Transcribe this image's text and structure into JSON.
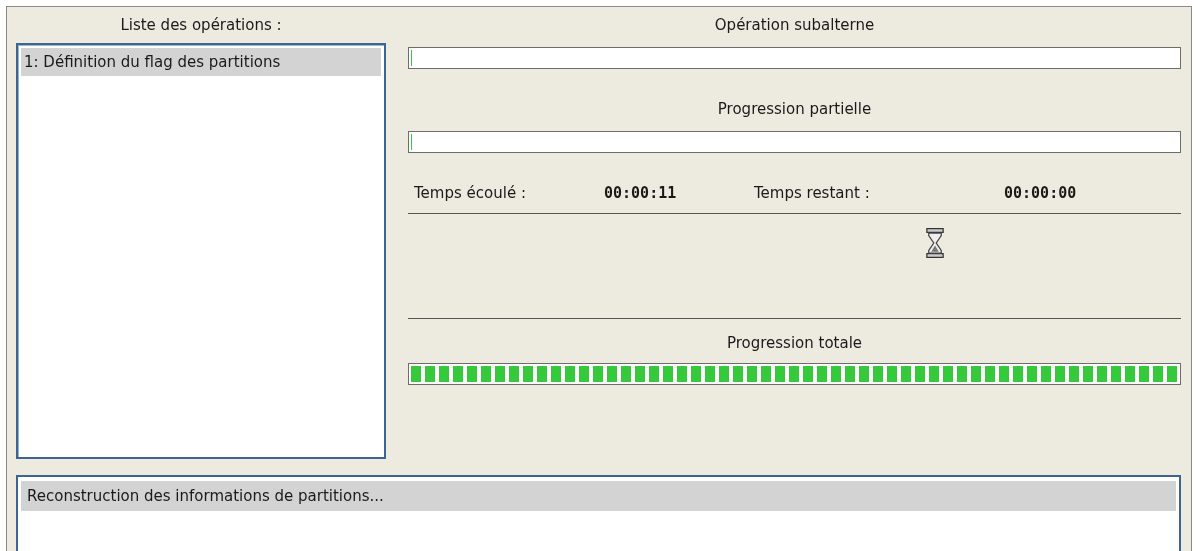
{
  "operations": {
    "title": "Liste des opérations :",
    "items": [
      {
        "label": "1: Définition du flag des partitions",
        "selected": true
      }
    ]
  },
  "sub_operation": {
    "label": "Opération subalterne",
    "level": 0
  },
  "partial_progress": {
    "label": "Progression partielle",
    "level": 0
  },
  "times": {
    "elapsed_label": "Temps écoulé :",
    "elapsed": "00:00:11",
    "remaining_label": "Temps restant :",
    "remaining": "00:00:00"
  },
  "total_progress": {
    "label": "Progression totale",
    "level": 1
  },
  "log": {
    "items": [
      {
        "label": "Reconstruction des informations de partitions...",
        "selected": true
      }
    ]
  }
}
